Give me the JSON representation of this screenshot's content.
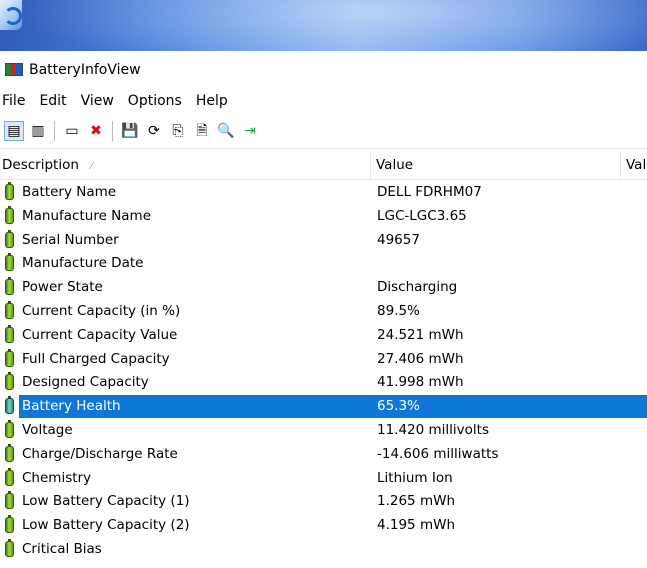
{
  "window": {
    "title": "BatteryInfoView"
  },
  "menu": [
    "File",
    "Edit",
    "View",
    "Options",
    "Help"
  ],
  "toolbar": {
    "buttons": [
      {
        "name": "simple-view-icon",
        "glyph": "▤"
      },
      {
        "name": "advanced-view-icon",
        "glyph": "▥"
      },
      {
        "name": "separator"
      },
      {
        "name": "properties-window-icon",
        "glyph": "▭"
      },
      {
        "name": "delete-icon",
        "glyph": "✖"
      },
      {
        "name": "separator"
      },
      {
        "name": "save-icon",
        "glyph": "💾"
      },
      {
        "name": "refresh-icon",
        "glyph": "⟳"
      },
      {
        "name": "copy-icon",
        "glyph": "⎘"
      },
      {
        "name": "properties-icon",
        "glyph": "🗎"
      },
      {
        "name": "find-icon",
        "glyph": "🔍"
      },
      {
        "name": "exit-icon",
        "glyph": "⇥"
      }
    ]
  },
  "columns": {
    "description": "Description",
    "value": "Value",
    "value2": "Val"
  },
  "rows": [
    {
      "desc": "Battery Name",
      "value": "DELL FDRHM07"
    },
    {
      "desc": "Manufacture Name",
      "value": "LGC-LGC3.65"
    },
    {
      "desc": "Serial Number",
      "value": "49657"
    },
    {
      "desc": "Manufacture Date",
      "value": ""
    },
    {
      "desc": "Power State",
      "value": "Discharging"
    },
    {
      "desc": "Current Capacity (in %)",
      "value": "89.5%"
    },
    {
      "desc": "Current Capacity Value",
      "value": "24.521 mWh"
    },
    {
      "desc": "Full Charged Capacity",
      "value": "27.406 mWh"
    },
    {
      "desc": "Designed Capacity",
      "value": "41.998 mWh"
    },
    {
      "desc": "Battery Health",
      "value": "65.3%",
      "selected": true
    },
    {
      "desc": "Voltage",
      "value": "11.420 millivolts"
    },
    {
      "desc": "Charge/Discharge Rate",
      "value": "-14.606 milliwatts"
    },
    {
      "desc": "Chemistry",
      "value": "Lithium Ion"
    },
    {
      "desc": "Low Battery Capacity (1)",
      "value": "1.265 mWh"
    },
    {
      "desc": "Low Battery Capacity (2)",
      "value": "4.195 mWh"
    },
    {
      "desc": "Critical Bias",
      "value": ""
    }
  ]
}
